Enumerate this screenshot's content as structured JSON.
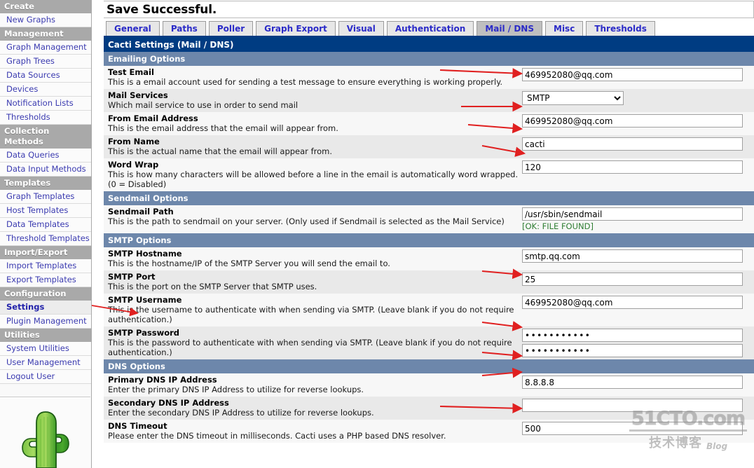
{
  "sidebar": {
    "groups": [
      {
        "header": "Create",
        "items": [
          "New Graphs"
        ]
      },
      {
        "header": "Management",
        "items": [
          "Graph Management",
          "Graph Trees",
          "Data Sources",
          "Devices",
          "Notification Lists",
          "Thresholds"
        ]
      },
      {
        "header": "Collection Methods",
        "items": [
          "Data Queries",
          "Data Input Methods"
        ]
      },
      {
        "header": "Templates",
        "items": [
          "Graph Templates",
          "Host Templates",
          "Data Templates",
          "Threshold Templates"
        ]
      },
      {
        "header": "Import/Export",
        "items": [
          "Import Templates",
          "Export Templates"
        ]
      },
      {
        "header": "Configuration",
        "items": [
          "Settings",
          "Plugin Management"
        ]
      },
      {
        "header": "Utilities",
        "items": [
          "System Utilities",
          "User Management",
          "Logout User"
        ]
      }
    ],
    "selected": "Settings",
    "logo_alt": "cactus-logo"
  },
  "message": {
    "save_successful": "Save Successful."
  },
  "tabs": [
    {
      "label": "General",
      "active": false
    },
    {
      "label": "Paths",
      "active": false
    },
    {
      "label": "Poller",
      "active": false
    },
    {
      "label": "Graph Export",
      "active": false
    },
    {
      "label": "Visual",
      "active": false
    },
    {
      "label": "Authentication",
      "active": false
    },
    {
      "label": "Mail / DNS",
      "active": true
    },
    {
      "label": "Misc",
      "active": false
    },
    {
      "label": "Thresholds",
      "active": false
    }
  ],
  "page_header": "Cacti Settings (Mail / DNS)",
  "sections": {
    "emailing": {
      "header": "Emailing Options",
      "rows": [
        {
          "name": "Test Email",
          "desc": "This is a email account used for sending a test message to ensure everything is working properly.",
          "control": "text",
          "value": "469952080@qq.com",
          "arrow": true
        },
        {
          "name": "Mail Services",
          "desc": "Which mail service to use in order to send mail",
          "control": "select",
          "value": "SMTP",
          "options": [
            "SMTP"
          ],
          "arrow": true
        },
        {
          "name": "From Email Address",
          "desc": "This is the email address that the email will appear from.",
          "control": "text",
          "value": "469952080@qq.com",
          "arrow": true
        },
        {
          "name": "From Name",
          "desc": "This is the actual name that the email will appear from.",
          "control": "text",
          "value": "cacti",
          "arrow": true
        },
        {
          "name": "Word Wrap",
          "desc": "This is how many characters will be allowed before a line in the email is automatically word wrapped. (0 = Disabled)",
          "control": "text",
          "value": "120",
          "arrow": false
        }
      ]
    },
    "sendmail": {
      "header": "Sendmail Options",
      "rows": [
        {
          "name": "Sendmail Path",
          "desc": "This is the path to sendmail on your server. (Only used if Sendmail is selected as the Mail Service)",
          "control": "text",
          "value": "/usr/sbin/sendmail",
          "note": "[OK: FILE FOUND]",
          "arrow": false
        }
      ]
    },
    "smtp": {
      "header": "SMTP Options",
      "rows": [
        {
          "name": "SMTP Hostname",
          "desc": "This is the hostname/IP of the SMTP Server you will send the email to.",
          "control": "text",
          "value": "smtp.qq.com",
          "arrow": true
        },
        {
          "name": "SMTP Port",
          "desc": "This is the port on the SMTP Server that SMTP uses.",
          "control": "text",
          "value": "25",
          "arrow": false
        },
        {
          "name": "SMTP Username",
          "desc": "This is the username to authenticate with when sending via SMTP. (Leave blank if you do not require authentication.)",
          "control": "text",
          "value": "469952080@qq.com",
          "arrow": true
        },
        {
          "name": "SMTP Password",
          "desc": "This is the password to authenticate with when sending via SMTP. (Leave blank if you do not require authentication.)",
          "control": "password2",
          "value": "•••••••••••",
          "value_confirm": "•••••••••••",
          "arrow": true
        }
      ]
    },
    "dns": {
      "header": "DNS Options",
      "rows": [
        {
          "name": "Primary DNS IP Address",
          "desc": "Enter the primary DNS IP Address to utilize for reverse lookups.",
          "control": "text",
          "value": "8.8.8.8",
          "arrow": true
        },
        {
          "name": "Secondary DNS IP Address",
          "desc": "Enter the secondary DNS IP Address to utilize for reverse lookups.",
          "control": "text",
          "value": "",
          "arrow": false
        },
        {
          "name": "DNS Timeout",
          "desc": "Please enter the DNS timeout in milliseconds. Cacti uses a PHP based DNS resolver.",
          "control": "text",
          "value": "500",
          "arrow": false
        }
      ]
    }
  },
  "watermark": {
    "main": "51CTO.com",
    "cn": "技术博客",
    "blog": "Blog"
  },
  "colors": {
    "page_header_bg": "#003c82",
    "section_header_bg": "#6d87ab",
    "nav_header_bg": "#a9a9a9",
    "link": "#3a3ab0",
    "tab_text": "#2b2bc8",
    "arrow": "#e02020",
    "ok_note": "#2e7d32"
  }
}
